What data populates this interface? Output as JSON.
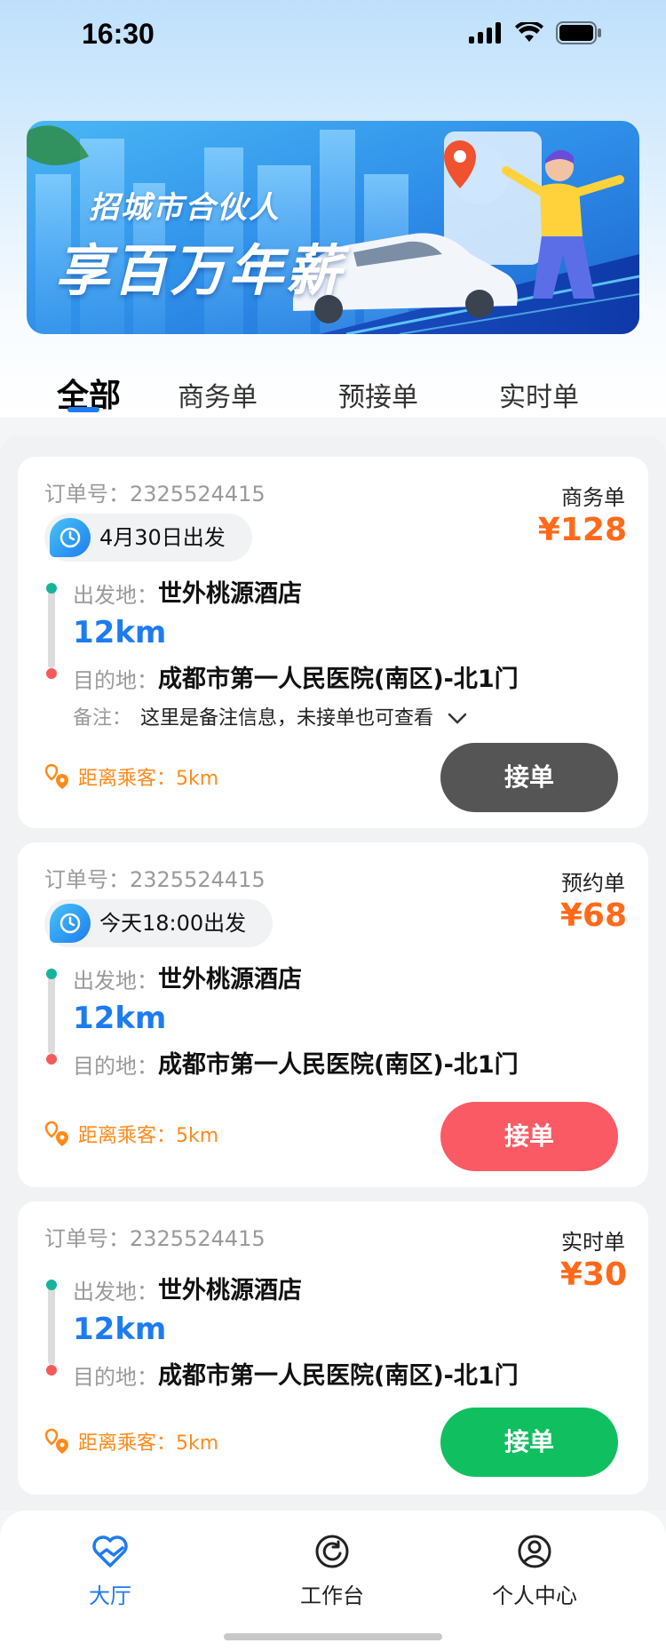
{
  "status_bar": {
    "time": "16:30"
  },
  "banner": {
    "line1": "招城市合伙人",
    "line2": "享百万年薪"
  },
  "tabs": [
    {
      "label": "全部",
      "active": true
    },
    {
      "label": "商务单",
      "active": false
    },
    {
      "label": "预接单",
      "active": false
    },
    {
      "label": "实时单",
      "active": false
    }
  ],
  "orders": [
    {
      "order_no": "订单号：2325524415",
      "type": "商务单",
      "price": "¥128",
      "depart": "4月30日出发",
      "from_label": "出发地：",
      "from": "世外桃源酒店",
      "distance": "12km",
      "to_label": "目的地：",
      "to": "成都市第一人民医院(南区)-北1门",
      "remark_label": "备注：",
      "remark": "这里是备注信息，未接单也可查看",
      "passenger_distance": "距离乘客：5km",
      "button": "接单",
      "button_color": "#555555"
    },
    {
      "order_no": "订单号：2325524415",
      "type": "预约单",
      "price": "¥68",
      "depart": "今天18:00出发",
      "from_label": "出发地：",
      "from": "世外桃源酒店",
      "distance": "12km",
      "to_label": "目的地：",
      "to": "成都市第一人民医院(南区)-北1门",
      "passenger_distance": "距离乘客：5km",
      "button": "接单",
      "button_color": "#fa5a64"
    },
    {
      "order_no": "订单号：2325524415",
      "type": "实时单",
      "price": "¥30",
      "from_label": "出发地：",
      "from": "世外桃源酒店",
      "distance": "12km",
      "to_label": "目的地：",
      "to": "成都市第一人民医院(南区)-北1门",
      "passenger_distance": "距离乘客：5km",
      "button": "接单",
      "button_color": "#10c060"
    }
  ],
  "tabbar": [
    {
      "label": "大厅",
      "icon": "heart-hand-icon",
      "active": true
    },
    {
      "label": "工作台",
      "icon": "refresh-circle-icon",
      "active": false
    },
    {
      "label": "个人中心",
      "icon": "user-circle-icon",
      "active": false
    }
  ],
  "colors": {
    "accent": "#1e7bf0",
    "price": "#ff6a1a",
    "passenger": "#ff8a1a"
  }
}
